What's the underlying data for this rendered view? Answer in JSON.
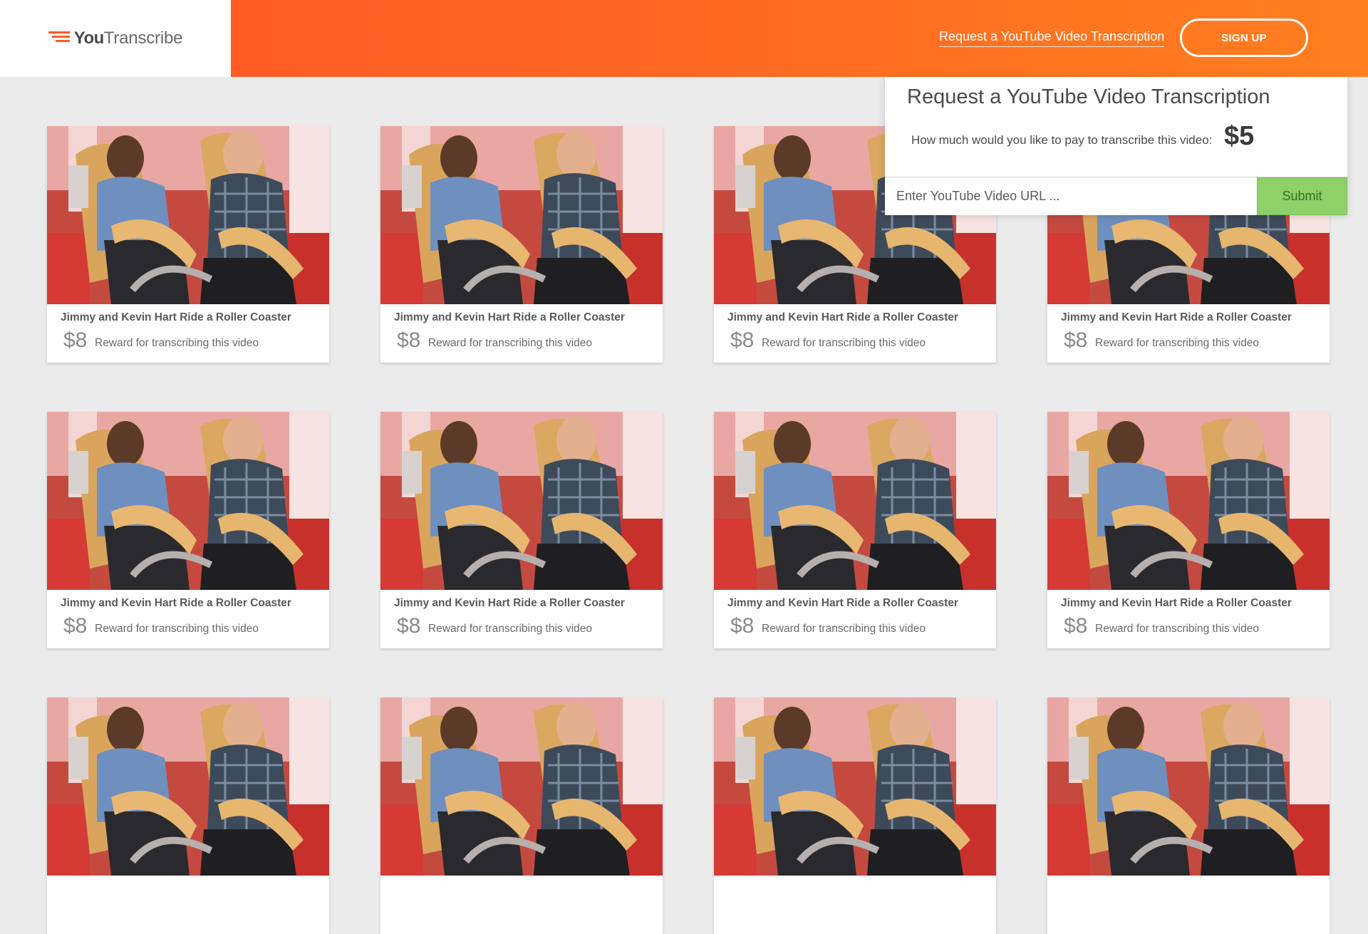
{
  "brand": {
    "you": "You",
    "transcribe": "Transcribe",
    "accent": "#ff5a24"
  },
  "header": {
    "request_link": "Request a YouTube Video Transcription",
    "signup_label": "SIGN UP"
  },
  "panel": {
    "title": "Request a YouTube Video Transcription",
    "question": "How much would you like to pay to transcribe this video:",
    "amount": "$5",
    "url_placeholder": "Enter YouTube Video URL ...",
    "submit_label": "Submit",
    "submit_color": "#8ed16b"
  },
  "cards": [
    {
      "title": "Jimmy and Kevin Hart Ride a Roller Coaster",
      "price": "$8",
      "reward_text": "Reward for transcribing this video"
    },
    {
      "title": "Jimmy and Kevin Hart Ride a Roller Coaster",
      "price": "$8",
      "reward_text": "Reward for transcribing this video"
    },
    {
      "title": "Jimmy and Kevin Hart Ride a Roller Coaster",
      "price": "$8",
      "reward_text": "Reward for transcribing this video"
    },
    {
      "title": "Jimmy and Kevin Hart Ride a Roller Coaster",
      "price": "$8",
      "reward_text": "Reward for transcribing this video"
    },
    {
      "title": "Jimmy and Kevin Hart Ride a Roller Coaster",
      "price": "$8",
      "reward_text": "Reward for transcribing this video"
    },
    {
      "title": "Jimmy and Kevin Hart Ride a Roller Coaster",
      "price": "$8",
      "reward_text": "Reward for transcribing this video"
    },
    {
      "title": "Jimmy and Kevin Hart Ride a Roller Coaster",
      "price": "$8",
      "reward_text": "Reward for transcribing this video"
    },
    {
      "title": "Jimmy and Kevin Hart Ride a Roller Coaster",
      "price": "$8",
      "reward_text": "Reward for transcribing this video"
    },
    {
      "title": "",
      "price": "",
      "reward_text": ""
    },
    {
      "title": "",
      "price": "",
      "reward_text": ""
    },
    {
      "title": "",
      "price": "",
      "reward_text": ""
    },
    {
      "title": "",
      "price": "",
      "reward_text": ""
    }
  ]
}
